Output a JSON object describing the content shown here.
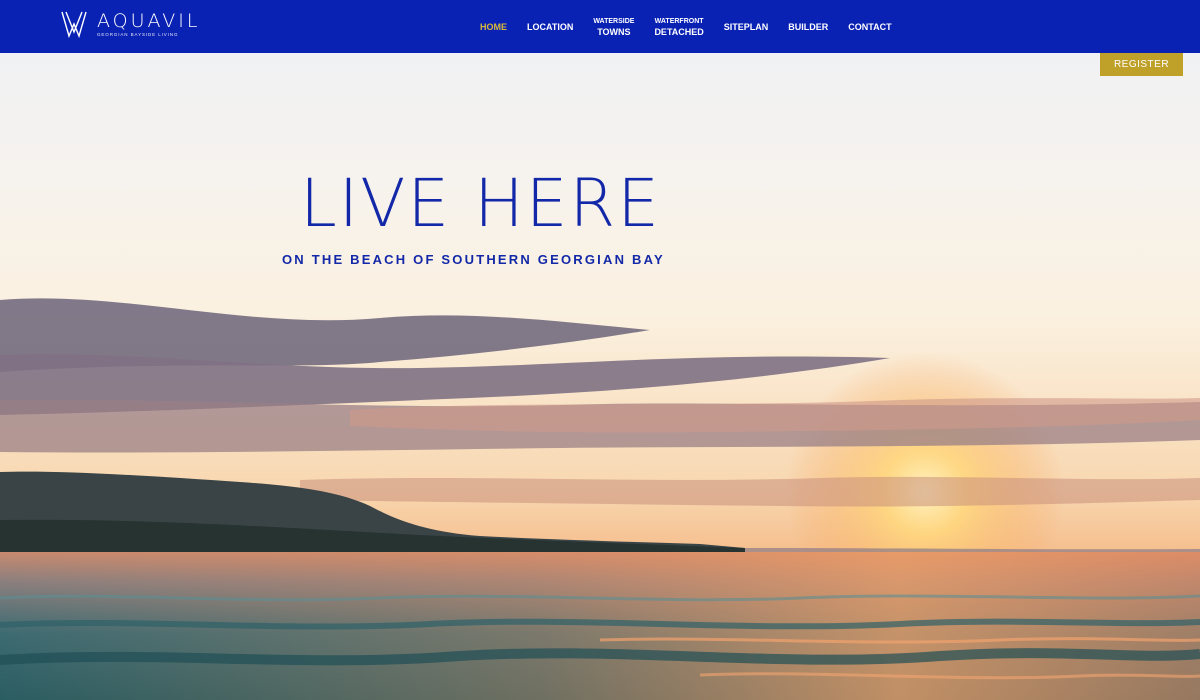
{
  "brand": {
    "name": "AQUAVIL",
    "tagline": "GEORGIAN BAYSIDE LIVING"
  },
  "nav": {
    "items": [
      {
        "line1": "",
        "line2": "HOME",
        "active": true
      },
      {
        "line1": "",
        "line2": "LOCATION",
        "active": false
      },
      {
        "line1": "WATERSIDE",
        "line2": "TOWNS",
        "active": false
      },
      {
        "line1": "WATERFRONT",
        "line2": "DETACHED",
        "active": false
      },
      {
        "line1": "",
        "line2": "SITEPLAN",
        "active": false
      },
      {
        "line1": "",
        "line2": "BUILDER",
        "active": false
      },
      {
        "line1": "",
        "line2": "CONTACT",
        "active": false
      }
    ]
  },
  "register_label": "REGISTER",
  "hero": {
    "title": "LIVE HERE",
    "subtitle": "ON THE BEACH OF SOUTHERN GEORGIAN BAY"
  },
  "colors": {
    "nav_bg": "#0a22b4",
    "accent_gold": "#bfa12a",
    "active_link": "#d9b93a",
    "headline_blue": "#1328a8"
  }
}
